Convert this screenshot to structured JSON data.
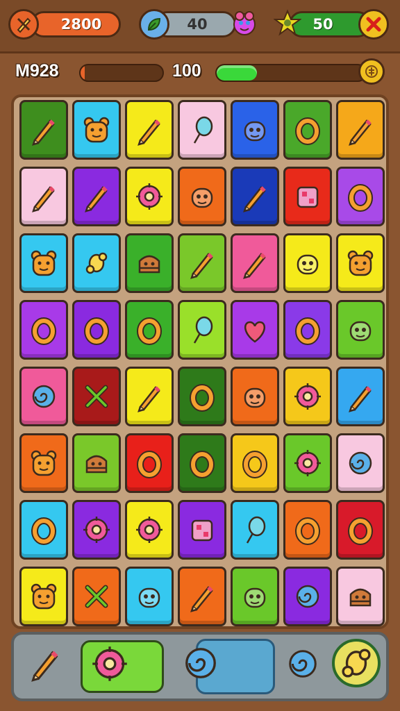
{
  "header": {
    "coins_value": "2800",
    "time_value": "40",
    "gems_value": "50",
    "colors": {
      "coins": "#e8642a",
      "time": "#8ea0a8",
      "gems": "#2e9a2e",
      "close": "#f0c020"
    }
  },
  "stats": {
    "level_label": "M928",
    "score_label": "100",
    "level_progress": 0.05,
    "score_progress": 0.27
  },
  "board": {
    "rows": [
      [
        {
          "color": "#3e8e1e",
          "icon": "pencil"
        },
        {
          "color": "#35c8f0",
          "icon": "bear"
        },
        {
          "color": "#f5ea1a",
          "icon": "pencil"
        },
        {
          "color": "#f8c8e0",
          "icon": "lollipop"
        },
        {
          "color": "#2a62e8",
          "icon": "monster"
        },
        {
          "color": "#4aa82a",
          "icon": "ring"
        },
        {
          "color": "#f5a81a",
          "icon": "pencil"
        }
      ],
      [
        {
          "color": "#f8c8e0",
          "icon": "pencil"
        },
        {
          "color": "#8a2ae0",
          "icon": "pencil"
        },
        {
          "color": "#f5ea1a",
          "icon": "flower"
        },
        {
          "color": "#f06a1a",
          "icon": "monster"
        },
        {
          "color": "#1a3ab8",
          "icon": "pencil"
        },
        {
          "color": "#e82a1a",
          "icon": "box"
        },
        {
          "color": "#a84ae8",
          "icon": "ring"
        }
      ],
      [
        {
          "color": "#35c8f0",
          "icon": "bear"
        },
        {
          "color": "#35c8f0",
          "icon": "candy"
        },
        {
          "color": "#3ab02a",
          "icon": "cake"
        },
        {
          "color": "#7ac82a",
          "icon": "pencil"
        },
        {
          "color": "#f05a9a",
          "icon": "pencil"
        },
        {
          "color": "#f5ea1a",
          "icon": "monster"
        },
        {
          "color": "#f5ea1a",
          "icon": "bear"
        }
      ],
      [
        {
          "color": "#a83ae8",
          "icon": "ring"
        },
        {
          "color": "#8a2ae0",
          "icon": "ring"
        },
        {
          "color": "#3ab02a",
          "icon": "ring"
        },
        {
          "color": "#9ae02a",
          "icon": "lollipop"
        },
        {
          "color": "#a83ae8",
          "icon": "heart"
        },
        {
          "color": "#8a3ae8",
          "icon": "ring"
        },
        {
          "color": "#6ac82a",
          "icon": "monster"
        }
      ],
      [
        {
          "color": "#f05a9a",
          "icon": "swirl"
        },
        {
          "color": "#a81a1a",
          "icon": "sword"
        },
        {
          "color": "#f5ea1a",
          "icon": "pencil"
        },
        {
          "color": "#2e7a1a",
          "icon": "ring"
        },
        {
          "color": "#f06a1a",
          "icon": "monster"
        },
        {
          "color": "#f5c81a",
          "icon": "flower"
        },
        {
          "color": "#35a8f0",
          "icon": "pencil"
        }
      ],
      [
        {
          "color": "#f06a1a",
          "icon": "bear"
        },
        {
          "color": "#7ac82a",
          "icon": "cake"
        },
        {
          "color": "#e8201a",
          "icon": "ring"
        },
        {
          "color": "#2e7a1a",
          "icon": "ring"
        },
        {
          "color": "#f5c81a",
          "icon": "ring"
        },
        {
          "color": "#6ac82a",
          "icon": "flower"
        },
        {
          "color": "#f8c8e0",
          "icon": "swirl"
        }
      ],
      [
        {
          "color": "#35c8f0",
          "icon": "ring"
        },
        {
          "color": "#8a2ae0",
          "icon": "flower"
        },
        {
          "color": "#f5ea1a",
          "icon": "flower"
        },
        {
          "color": "#8a2ae0",
          "icon": "box"
        },
        {
          "color": "#35c8f0",
          "icon": "lollipop"
        },
        {
          "color": "#f06a1a",
          "icon": "ring"
        },
        {
          "color": "#d81a2a",
          "icon": "ring"
        }
      ],
      [
        {
          "color": "#f5ea1a",
          "icon": "bear"
        },
        {
          "color": "#f06a1a",
          "icon": "sword"
        },
        {
          "color": "#35c8f0",
          "icon": "monster"
        },
        {
          "color": "#f06a1a",
          "icon": "pencil"
        },
        {
          "color": "#6ac82a",
          "icon": "monster"
        },
        {
          "color": "#8a2ae0",
          "icon": "swirl"
        },
        {
          "color": "#f8c8e0",
          "icon": "cake"
        }
      ]
    ]
  },
  "bottom": {
    "buttons": [
      {
        "name": "pencil-booster-button",
        "icon": "pencil"
      },
      {
        "name": "sun-booster-button",
        "icon": "flower"
      },
      {
        "name": "swirl-booster-button",
        "icon": "swirl"
      },
      {
        "name": "candy-booster-button",
        "icon": "swirl"
      },
      {
        "name": "pacifier-booster-button",
        "icon": "candy"
      }
    ]
  }
}
